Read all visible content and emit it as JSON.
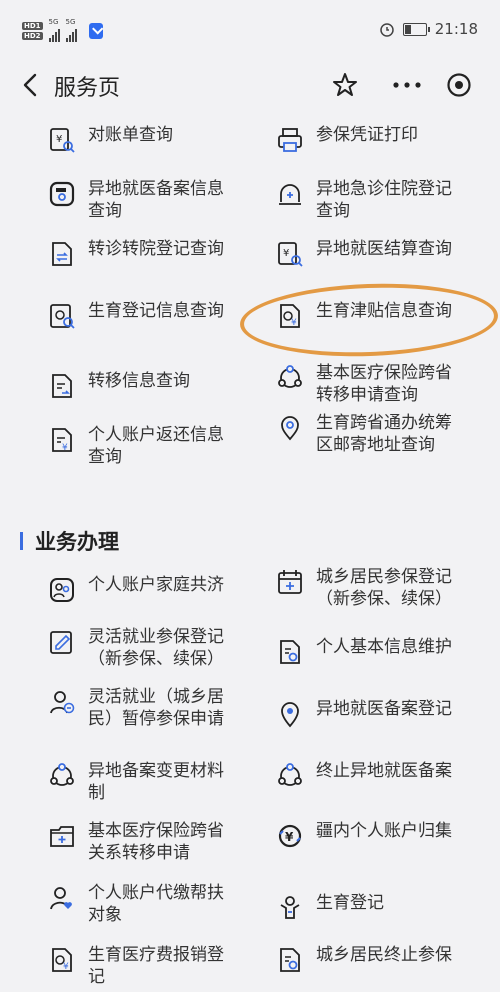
{
  "status": {
    "hd1": "HD1",
    "hd2": "HD2",
    "net1": "5G",
    "net2": "5G",
    "time": "21:18"
  },
  "nav": {
    "title": "服务页"
  },
  "query_items": [
    {
      "label": "对账单查询",
      "icon": "bill-search-icon"
    },
    {
      "label": "参保凭证打印",
      "icon": "printer-icon"
    },
    {
      "label": "异地就医备案信息查询",
      "icon": "record-search-icon"
    },
    {
      "label": "异地急诊住院登记查询",
      "icon": "ambulance-icon"
    },
    {
      "label": "转诊转院登记查询",
      "icon": "transfer-doc-icon"
    },
    {
      "label": "异地就医结算查询",
      "icon": "settlement-icon"
    },
    {
      "label": "生育登记信息查询",
      "icon": "maternity-search-icon"
    },
    {
      "label": "生育津贴信息查询",
      "icon": "allowance-doc-icon"
    },
    {
      "label": "转移信息查询",
      "icon": "transfer-list-icon"
    },
    {
      "label": "基本医疗保险跨省转移申请查询",
      "icon": "network-icon"
    },
    {
      "label": "个人账户返还信息查询",
      "icon": "refund-doc-icon"
    },
    {
      "label": "生育跨省通办统筹区邮寄地址查询",
      "icon": "location-pin-icon"
    }
  ],
  "section": {
    "title": "业务办理"
  },
  "business_items": [
    {
      "label": "个人账户家庭共济",
      "icon": "family-icon"
    },
    {
      "label": "城乡居民参保登记（新参保、续保）",
      "icon": "calendar-add-icon"
    },
    {
      "label": "灵活就业参保登记（新参保、续保）",
      "icon": "edit-doc-icon"
    },
    {
      "label": "个人基本信息维护",
      "icon": "info-settings-icon"
    },
    {
      "label": "灵活就业（城乡居民）暂停参保申请",
      "icon": "user-pause-icon"
    },
    {
      "label": "异地就医备案登记",
      "icon": "map-pin-icon"
    },
    {
      "label": "异地备案变更材料制",
      "icon": "network-icon"
    },
    {
      "label": "终止异地就医备案",
      "icon": "network-icon"
    },
    {
      "label": "基本医疗保险跨省关系转移申请",
      "icon": "folder-add-icon"
    },
    {
      "label": "疆内个人账户归集",
      "icon": "yuan-cycle-icon"
    },
    {
      "label": "个人账户代缴帮扶对象",
      "icon": "user-heart-icon"
    },
    {
      "label": "生育登记",
      "icon": "baby-icon"
    },
    {
      "label": "生育医疗费报销登记",
      "icon": "maternity-doc-icon"
    },
    {
      "label": "城乡居民终止参保",
      "icon": "info-settings-icon"
    }
  ]
}
